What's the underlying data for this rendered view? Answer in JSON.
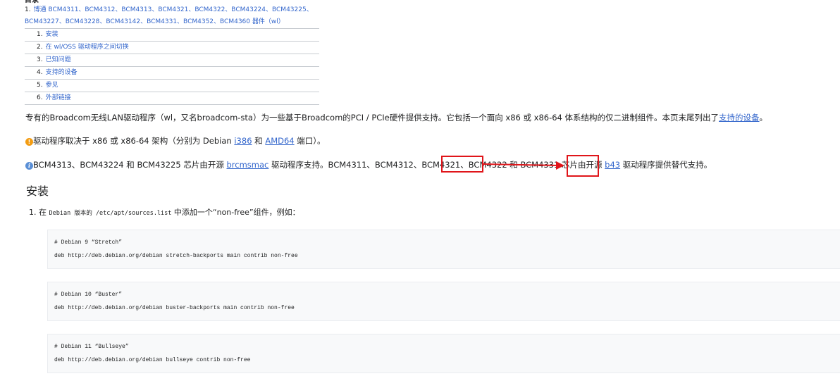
{
  "toc": {
    "title": "目录",
    "main_num": "1.",
    "main_line1": "博通 BCM4311、BCM4312、BCM4313、BCM4321、BCM4322、BCM43224、BCM43225、",
    "main_line2": "BCM43227、BCM43228、BCM43142、BCM4331、BCM4352、BCM4360 器件（wl）",
    "items": [
      {
        "num": "1.",
        "label": "安装"
      },
      {
        "num": "2.",
        "label": "在 wl/OSS 驱动程序之间切换"
      },
      {
        "num": "3.",
        "label": "已知问题"
      },
      {
        "num": "4.",
        "label": "支持的设备"
      },
      {
        "num": "5.",
        "label": "参见"
      },
      {
        "num": "6.",
        "label": "外部链接"
      }
    ]
  },
  "intro": {
    "text": "专有的Broadcom无线LAN驱动程序（wl，又名broadcom-sta）为一些基于Broadcom的PCI / PCIe硬件提供支持。它包括一个面向 x86 或 x86-64 体系结构的仅二进制组件。本页末尾列出了",
    "link": "支持的设备",
    "end": "。"
  },
  "warning": {
    "icon": "!",
    "text1": "驱动程序取决于 x86 或 x86-64 架构（分别为 Debian ",
    "link1": "i386",
    "mid": " 和 ",
    "link2": "AMD64",
    "text2": " 端口）。"
  },
  "info": {
    "icon": "i",
    "text1": "BCM4313、BCM43224 和 BCM43225 芯片由开源 ",
    "link1": "brcmsmac",
    "text2": " 驱动程序支持。BCM4311、BCM4312、BCM4321、",
    "chip": "BCM4322",
    "text3": " 和 BCM4331 芯片由开源 ",
    "link2": "b43",
    "text4": " 驱动程序提供替代支持。"
  },
  "section": {
    "heading": "安装"
  },
  "step1": {
    "num": "1.",
    "pre": "在 ",
    "code1": "Debian 版本的 /etc/apt/sources.list",
    "post": " 中添加一个“non-free”组件，例如："
  },
  "code_blocks": [
    {
      "comment": "# Debian 9 “Stretch”",
      "line": "deb http://deb.debian.org/debian stretch-backports main contrib non-free"
    },
    {
      "comment": "# Debian 10 “Buster”",
      "line": "deb http://deb.debian.org/debian buster-backports main contrib non-free"
    },
    {
      "comment": "# Debian 11 “Bullseye”",
      "line": "deb http://deb.debian.org/debian bullseye contrib non-free"
    }
  ],
  "colors": {
    "link": "#3366cc",
    "annotation": "#e0151a",
    "code_bg": "#f8f9fa"
  }
}
